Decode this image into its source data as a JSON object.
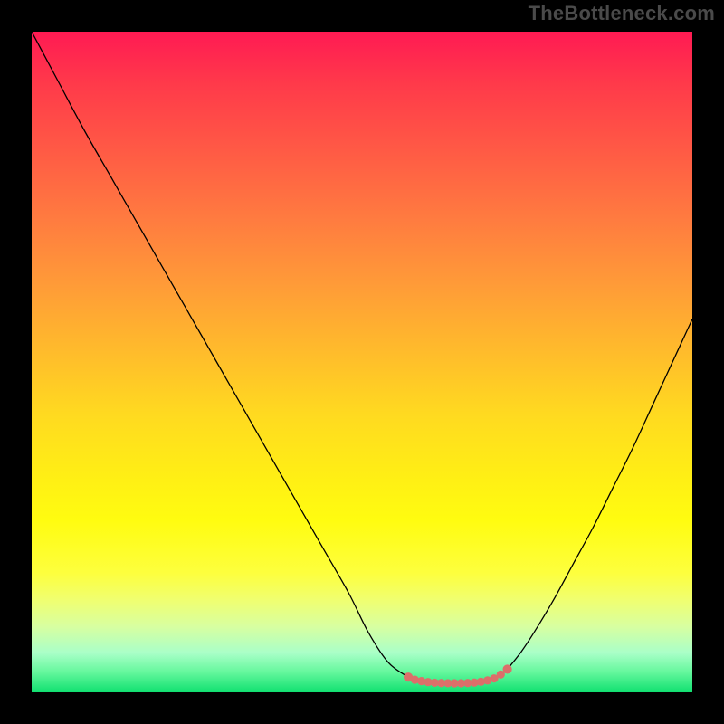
{
  "watermark": "TheBottleneck.com",
  "chart_data": {
    "type": "line",
    "title": "",
    "xlabel": "",
    "ylabel": "",
    "xlim": [
      0,
      100
    ],
    "ylim": [
      0,
      100
    ],
    "series": [
      {
        "name": "left-curve",
        "x": [
          0,
          4,
          8,
          12,
          16,
          20,
          24,
          28,
          32,
          36,
          40,
          44,
          48,
          51,
          54,
          57
        ],
        "y": [
          100,
          92.5,
          85,
          78,
          71,
          64,
          57,
          50,
          43,
          36,
          29,
          22,
          15,
          9,
          4.5,
          2.3
        ]
      },
      {
        "name": "right-curve",
        "x": [
          72,
          74,
          76,
          79,
          82,
          85,
          88,
          91,
          94,
          97,
          100
        ],
        "y": [
          3.5,
          6,
          9,
          14,
          19.5,
          25,
          31,
          37,
          43.5,
          50,
          56.5
        ]
      },
      {
        "name": "bottom-marker-segment",
        "x": [
          57,
          58,
          59,
          60,
          61,
          62,
          63,
          64,
          65,
          66,
          67,
          68,
          69,
          70,
          71,
          72
        ],
        "y": [
          2.3,
          1.9,
          1.7,
          1.55,
          1.45,
          1.4,
          1.38,
          1.37,
          1.37,
          1.4,
          1.48,
          1.6,
          1.8,
          2.1,
          2.7,
          3.5
        ]
      }
    ],
    "gradient_colors": {
      "top": "#ff1a53",
      "mid_upper": "#ff9a38",
      "mid": "#ffda20",
      "mid_lower": "#fdff3e",
      "bottom": "#10e070"
    },
    "marker_color": "#dc6f6a",
    "curve_color": "#000000"
  }
}
